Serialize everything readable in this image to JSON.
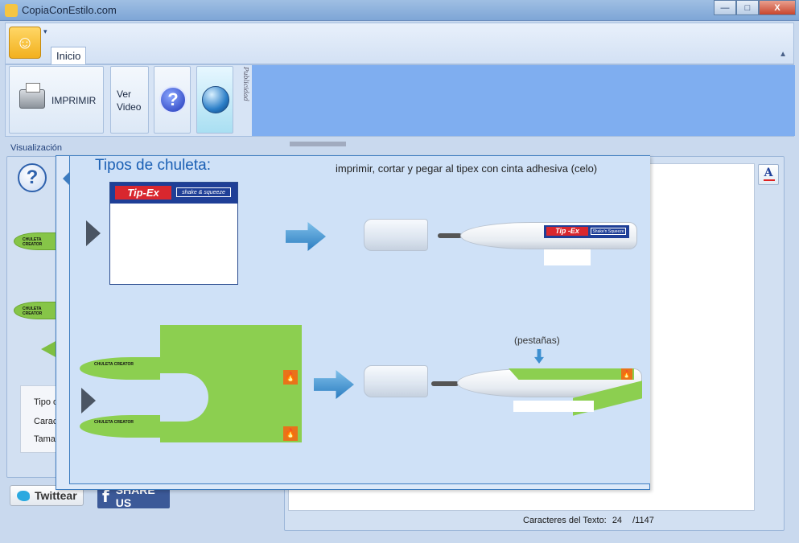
{
  "window": {
    "title": "CopiaConEstilo.com",
    "buttons": {
      "minimize": "—",
      "maximize": "□",
      "close": "X"
    }
  },
  "ribbon": {
    "tab": "Inicio",
    "print_label": "IMPRIMIR",
    "video_label": "Ver Video",
    "help_glyph": "?",
    "ad_vertical": "Publicidad"
  },
  "left_panel": {
    "section_label": "Visualización",
    "help_glyph": "?",
    "leaf_text_1": "CHULETA CREATOR",
    "leaf_text_2": "CHULETA CREATOR",
    "field_1": "Tipo d",
    "field_2": "Caract",
    "field_3": "Tamañ"
  },
  "social": {
    "twitter_label": "Twittear",
    "share_label": "SHARE US",
    "facebook_glyph": "f"
  },
  "right_panel": {
    "font_button_glyph": "A",
    "char_label": "Caracteres del Texto:",
    "char_count": "24",
    "char_max": "/1147"
  },
  "help_overlay": {
    "title": "Tipos de chuleta:",
    "instructions": "imprimir, cortar y pegar al tipex con cinta adhesiva (celo)",
    "brand": "Tip-Ex",
    "brand_slogan": "shake & squeeze",
    "pen_brand": "Tip -Ex",
    "pen_slogan": "Shake'n Squeeze",
    "pestanas": "(pestañas)",
    "leaf_a": "CHULETA CREATOR",
    "leaf_b": "CHULETA CREATOR",
    "flame_glyph": "🔥"
  },
  "colors": {
    "accent_blue": "#1a5fb4",
    "cheat_green": "#8ccf50",
    "tipex_blue": "#1f3f97",
    "tipex_red": "#d9272e",
    "facebook_blue": "#3b5998"
  },
  "icons": [
    "app-icon",
    "printer-icon",
    "help-icon",
    "globe-icon",
    "font-color-icon",
    "twitter-bird-icon",
    "facebook-icon",
    "flame-icon"
  ]
}
